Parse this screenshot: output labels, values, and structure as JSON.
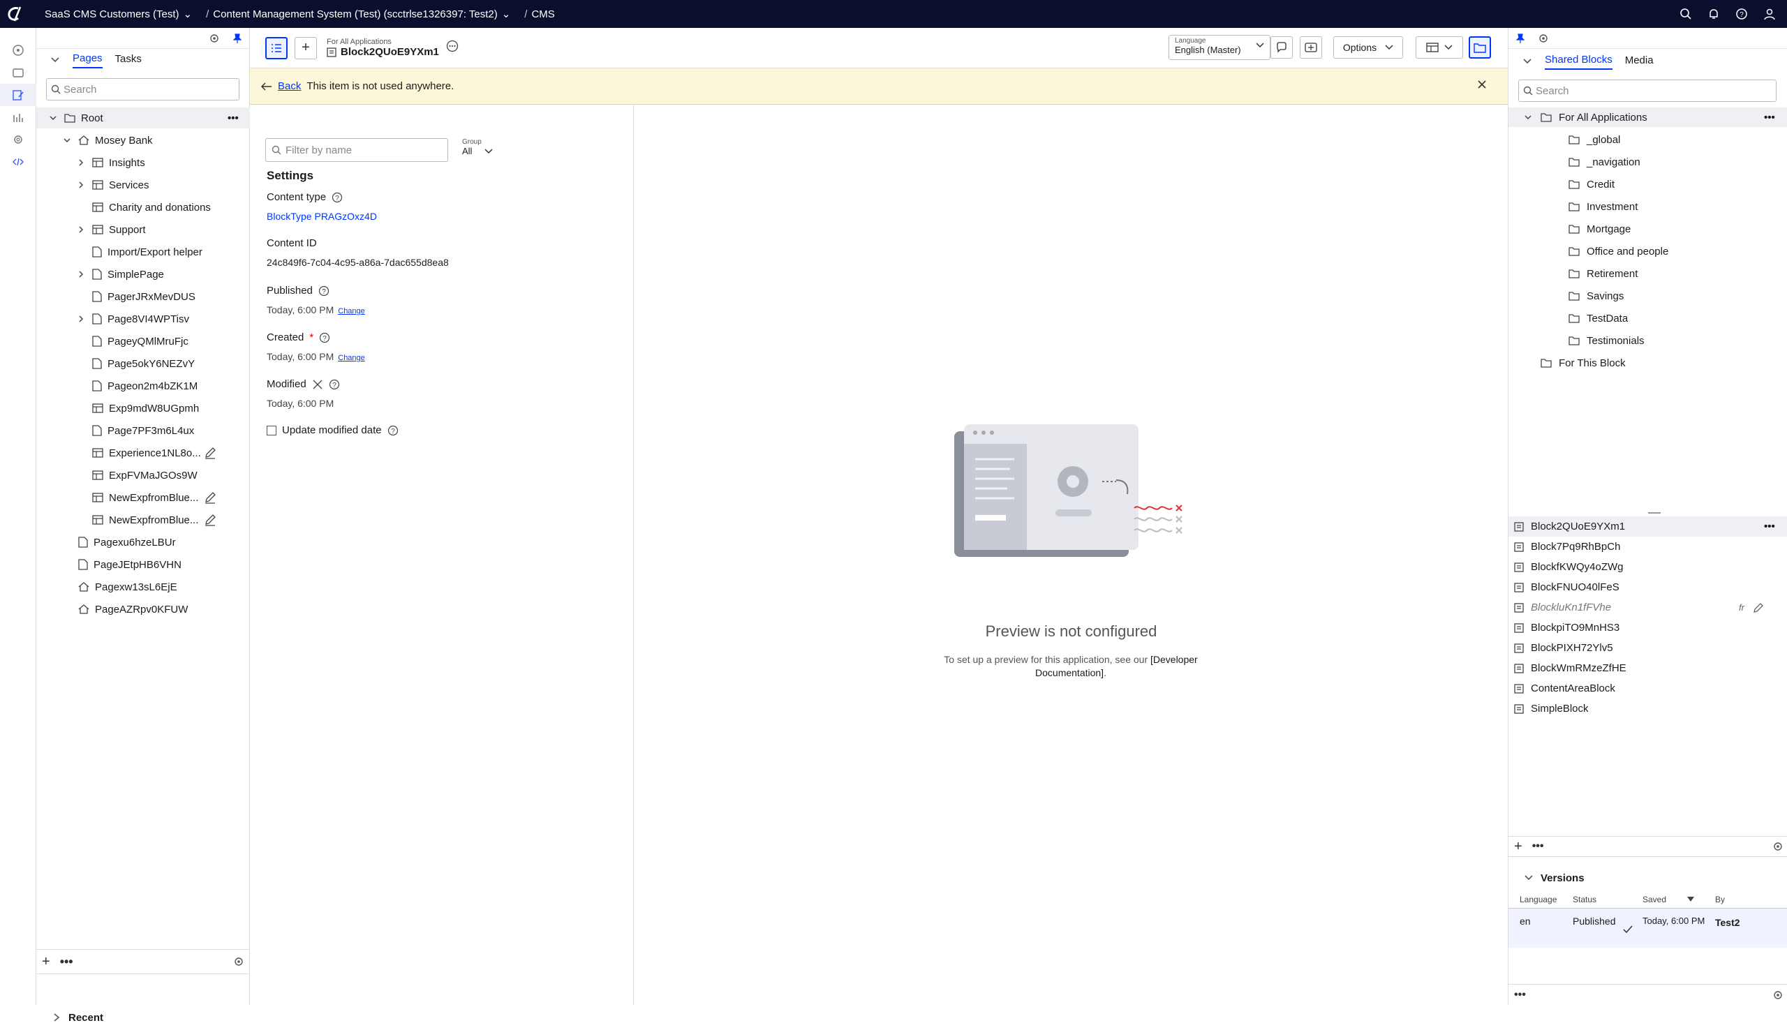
{
  "topbar": {
    "org": "SaaS CMS Customers (Test)",
    "project": "Content Management System (Test) (scctrlse1326397: Test2)",
    "app": "CMS"
  },
  "left": {
    "tabs": [
      "Pages",
      "Tasks"
    ],
    "search_placeholder": "Search",
    "tree": [
      {
        "label": "Root",
        "level": 0,
        "icon": "folder",
        "chevron": "open"
      },
      {
        "label": "Mosey Bank",
        "level": 1,
        "icon": "home",
        "chevron": "open"
      },
      {
        "label": "Insights",
        "level": 2,
        "icon": "table",
        "chevron": "closed"
      },
      {
        "label": "Services",
        "level": 2,
        "icon": "table",
        "chevron": "closed"
      },
      {
        "label": "Charity and donations",
        "level": 2,
        "icon": "table",
        "chevron": ""
      },
      {
        "label": "Support",
        "level": 2,
        "icon": "table",
        "chevron": "closed"
      },
      {
        "label": "Import/Export helper",
        "level": 2,
        "icon": "page",
        "chevron": ""
      },
      {
        "label": "SimplePage",
        "level": 2,
        "icon": "page",
        "chevron": "closed"
      },
      {
        "label": "PagerJRxMevDUS",
        "level": 2,
        "icon": "page",
        "chevron": ""
      },
      {
        "label": "Page8VI4WPTisv",
        "level": 2,
        "icon": "page",
        "chevron": "closed"
      },
      {
        "label": "PageyQMlMruFjc",
        "level": 2,
        "icon": "page",
        "chevron": ""
      },
      {
        "label": "Page5okY6NEZvY",
        "level": 2,
        "icon": "page",
        "chevron": ""
      },
      {
        "label": "Pageon2m4bZK1M",
        "level": 2,
        "icon": "page",
        "chevron": ""
      },
      {
        "label": "Exp9mdW8UGpmh",
        "level": 2,
        "icon": "table",
        "chevron": ""
      },
      {
        "label": "Page7PF3m6L4ux",
        "level": 2,
        "icon": "page",
        "chevron": ""
      },
      {
        "label": "Experience1NL8o...",
        "level": 2,
        "icon": "table",
        "chevron": "",
        "edit": true
      },
      {
        "label": "ExpFVMaJGOs9W",
        "level": 2,
        "icon": "table",
        "chevron": ""
      },
      {
        "label": "NewExpfromBlue...",
        "level": 2,
        "icon": "table",
        "chevron": "",
        "edit": true
      },
      {
        "label": "NewExpfromBlue...",
        "level": 2,
        "icon": "table",
        "chevron": "",
        "edit": true
      },
      {
        "label": "Pagexu6hzeLBUr",
        "level": 1,
        "icon": "page",
        "chevron": ""
      },
      {
        "label": "PageJEtpHB6VHN",
        "level": 1,
        "icon": "page",
        "chevron": ""
      },
      {
        "label": "Pagexw13sL6EjE",
        "level": 1,
        "icon": "home",
        "chevron": ""
      },
      {
        "label": "PageAZRpv0KFUW",
        "level": 1,
        "icon": "home",
        "chevron": ""
      }
    ],
    "recent": "Recent"
  },
  "toolbar": {
    "breadcrumb": "For All Applications",
    "title": "Block2QUoE9YXm1",
    "language_label": "Language",
    "language_value": "English (Master)",
    "options": "Options"
  },
  "banner": {
    "back": "Back",
    "message": "This item is not used anywhere."
  },
  "settings": {
    "filter_placeholder": "Filter by name",
    "group_label": "Group",
    "group_value": "All",
    "heading": "Settings",
    "content_type_label": "Content type",
    "content_type_value": "BlockType PRAGzOxz4D",
    "content_id_label": "Content ID",
    "content_id_value": "24c849f6-7c04-4c95-a86a-7dac655d8ea8",
    "published_label": "Published",
    "published_value": "Today, 6:00 PM",
    "change": "Change",
    "created_label": "Created",
    "created_value": "Today, 6:00 PM",
    "modified_label": "Modified",
    "modified_value": "Today, 6:00 PM",
    "update_modified": "Update modified date"
  },
  "preview": {
    "title": "Preview is not configured",
    "text1": "To set up a preview for this application, see our",
    "link": "[Developer Documentation]",
    "dot": "."
  },
  "right": {
    "tabs": [
      "Shared Blocks",
      "Media"
    ],
    "search_placeholder": "Search",
    "folders_root": "For All Applications",
    "folders": [
      "_global",
      "_navigation",
      "Credit",
      "Investment",
      "Mortgage",
      "Office and people",
      "Retirement",
      "Savings",
      "TestData",
      "Testimonials"
    ],
    "for_this_block": "For This Block",
    "blocks": [
      "Block2QUoE9YXm1",
      "Block7Pq9RhBpCh",
      "BlockfKWQy4oZWg",
      "BlockFNUO40lFeS",
      "BlockluKn1fFVhe",
      "BlockpiTO9MnHS3",
      "BlockPIXH72Ylv5",
      "BlockWmRMzeZfHE",
      "ContentAreaBlock",
      "SimpleBlock"
    ],
    "italic_block_lang": "fr",
    "versions": {
      "title": "Versions",
      "headers": [
        "Language",
        "Status",
        "Saved",
        "By"
      ],
      "row": {
        "language": "en",
        "status": "Published",
        "saved": "Today, 6:00 PM",
        "by": "Test2"
      }
    }
  },
  "colors": {
    "accent": "#0037ff",
    "topbar": "#0b0f2e",
    "banner": "#fdf7d9"
  }
}
